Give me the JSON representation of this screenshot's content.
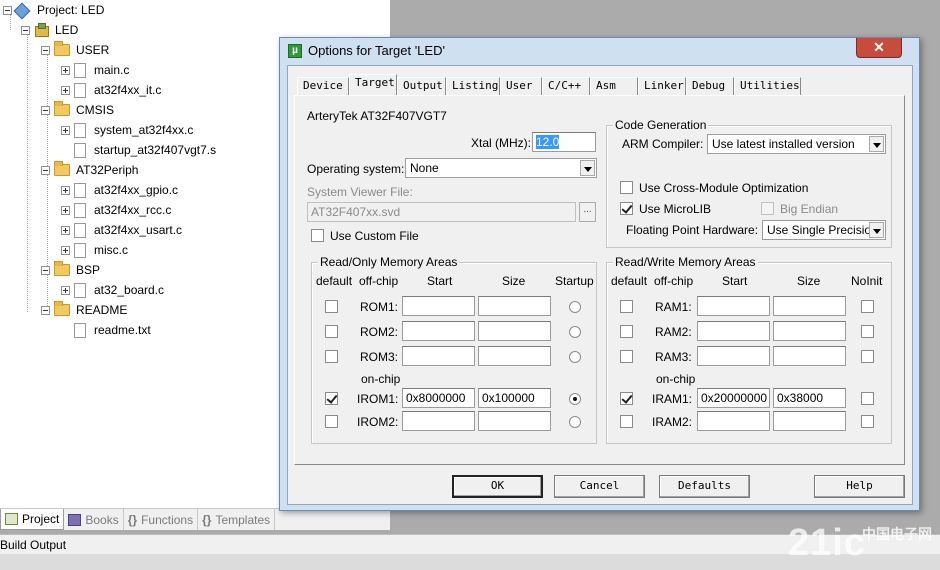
{
  "tree": {
    "project": "Project: LED",
    "target": "LED",
    "groups": [
      {
        "name": "USER",
        "files": [
          "main.c",
          "at32f4xx_it.c"
        ]
      },
      {
        "name": "CMSIS",
        "files": [
          "system_at32f4xx.c",
          "startup_at32f407vgt7.s"
        ]
      },
      {
        "name": "AT32Periph",
        "files": [
          "at32f4xx_gpio.c",
          "at32f4xx_rcc.c",
          "at32f4xx_usart.c",
          "misc.c"
        ]
      },
      {
        "name": "BSP",
        "files": [
          "at32_board.c"
        ]
      },
      {
        "name": "README",
        "files": [
          "readme.txt"
        ]
      }
    ]
  },
  "left_tabs": [
    "Project",
    "Books",
    "Functions",
    "Templates"
  ],
  "left_tab_icons": [
    "project-icon",
    "books-icon",
    "braces-icon",
    "template-icon"
  ],
  "build_output": "Build Output",
  "dialog": {
    "title": "Options for Target 'LED'",
    "close_label": "✕",
    "tabs": [
      "Device",
      "Target",
      "Output",
      "Listing",
      "User",
      "C/C++",
      "Asm",
      "Linker",
      "Debug",
      "Utilities"
    ],
    "active_tab": "Target",
    "device": "ArteryTek AT32F407VGT7",
    "xtal_label": "Xtal (MHz):",
    "xtal_value": "12.0",
    "os_label": "Operating system:",
    "os_value": "None",
    "svf_label": "System Viewer File:",
    "svf_value": "AT32F407xx.svd",
    "browse_label": "...",
    "use_custom_file": "Use Custom File",
    "code_gen": {
      "title": "Code Generation",
      "compiler_label": "ARM Compiler:",
      "compiler_value": "Use latest installed version",
      "cross_module": "Use Cross-Module Optimization",
      "microlib": "Use MicroLIB",
      "big_endian": "Big Endian",
      "fp_label": "Floating Point Hardware:",
      "fp_value": "Use Single Precision"
    },
    "rom": {
      "title": "Read/Only Memory Areas",
      "headers": [
        "default",
        "off-chip",
        "Start",
        "Size",
        "Startup"
      ],
      "onchip": "on-chip",
      "rows": [
        {
          "label": "ROM1:",
          "start": "",
          "size": "",
          "default": false,
          "startup": false
        },
        {
          "label": "ROM2:",
          "start": "",
          "size": "",
          "default": false,
          "startup": false
        },
        {
          "label": "ROM3:",
          "start": "",
          "size": "",
          "default": false,
          "startup": false
        },
        {
          "label": "IROM1:",
          "start": "0x8000000",
          "size": "0x100000",
          "default": true,
          "startup": true
        },
        {
          "label": "IROM2:",
          "start": "",
          "size": "",
          "default": false,
          "startup": false
        }
      ]
    },
    "ram": {
      "title": "Read/Write Memory Areas",
      "headers": [
        "default",
        "off-chip",
        "Start",
        "Size",
        "NoInit"
      ],
      "onchip": "on-chip",
      "rows": [
        {
          "label": "RAM1:",
          "start": "",
          "size": "",
          "default": false
        },
        {
          "label": "RAM2:",
          "start": "",
          "size": "",
          "default": false
        },
        {
          "label": "RAM3:",
          "start": "",
          "size": "",
          "default": false
        },
        {
          "label": "IRAM1:",
          "start": "0x20000000",
          "size": "0x38000",
          "default": true
        },
        {
          "label": "IRAM2:",
          "start": "",
          "size": "",
          "default": false
        }
      ]
    },
    "buttons": {
      "ok": "OK",
      "cancel": "Cancel",
      "defaults": "Defaults",
      "help": "Help"
    }
  },
  "watermark": {
    "main": "21ic",
    "sub": "中国电子网"
  },
  "colors": {
    "title_bg": "#cfe0f1",
    "close_btn": "#c84c3c",
    "selection": "#3399ff",
    "folder": "#f1c95f"
  }
}
